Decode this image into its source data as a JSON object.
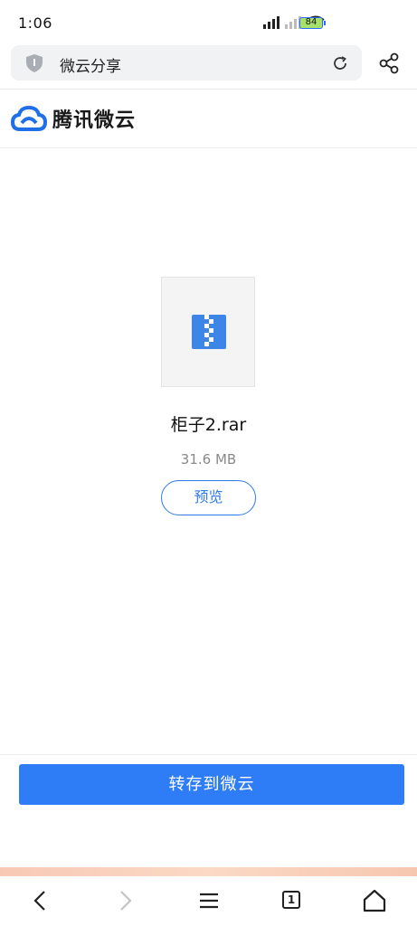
{
  "status_bar": {
    "time": "1:06",
    "battery": "84"
  },
  "url_bar": {
    "title": "微云分享"
  },
  "brand": {
    "name": "腾讯微云"
  },
  "file": {
    "name": "柜子2.rar",
    "size": "31.6 MB",
    "preview_label": "预览"
  },
  "save_button": {
    "label": "转存到微云"
  },
  "bottom_nav": {
    "tab_count": "1"
  },
  "colors": {
    "accent": "#2f7df6",
    "outline_accent": "#2f7be7"
  }
}
